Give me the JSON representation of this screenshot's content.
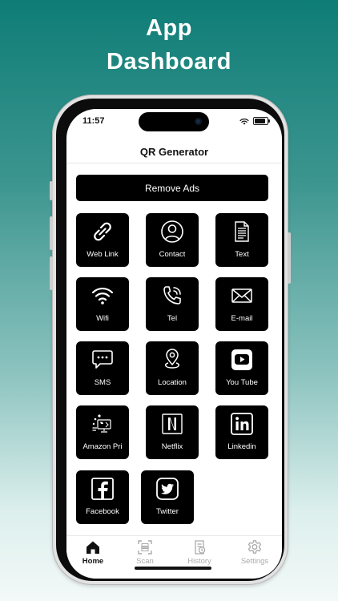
{
  "headline": {
    "line1": "App",
    "line2": "Dashboard"
  },
  "status_bar": {
    "time": "11:57"
  },
  "nav": {
    "title": "QR Generator"
  },
  "remove_ads": {
    "label": "Remove Ads"
  },
  "tiles": [
    {
      "label": "Web Link",
      "icon": "link-icon"
    },
    {
      "label": "Contact",
      "icon": "contact-icon"
    },
    {
      "label": "Text",
      "icon": "document-icon"
    },
    {
      "label": "Wifi",
      "icon": "wifi-icon"
    },
    {
      "label": "Tel",
      "icon": "phone-icon"
    },
    {
      "label": "E-mail",
      "icon": "envelope-icon"
    },
    {
      "label": "SMS",
      "icon": "chat-bubble-icon"
    },
    {
      "label": "Location",
      "icon": "map-pin-icon"
    },
    {
      "label": "You Tube",
      "icon": "youtube-icon"
    },
    {
      "label": "Amazon Pri",
      "icon": "amazon-prime-icon"
    },
    {
      "label": "Netflix",
      "icon": "netflix-icon"
    },
    {
      "label": "Linkedin",
      "icon": "linkedin-icon"
    },
    {
      "label": "Facebook",
      "icon": "facebook-icon"
    },
    {
      "label": "Twitter",
      "icon": "twitter-icon"
    }
  ],
  "tabbar": {
    "items": [
      {
        "label": "Home",
        "icon": "home-icon",
        "active": true
      },
      {
        "label": "Scan",
        "icon": "scan-icon",
        "active": false
      },
      {
        "label": "History",
        "icon": "history-icon",
        "active": false
      },
      {
        "label": "Settings",
        "icon": "gear-icon",
        "active": false
      }
    ]
  },
  "colors": {
    "background_top": "#0e7d76",
    "background_bottom": "#f3f9f8",
    "tile": "#000000",
    "tab_active": "#111111",
    "tab_inactive": "#aaaaaa"
  }
}
